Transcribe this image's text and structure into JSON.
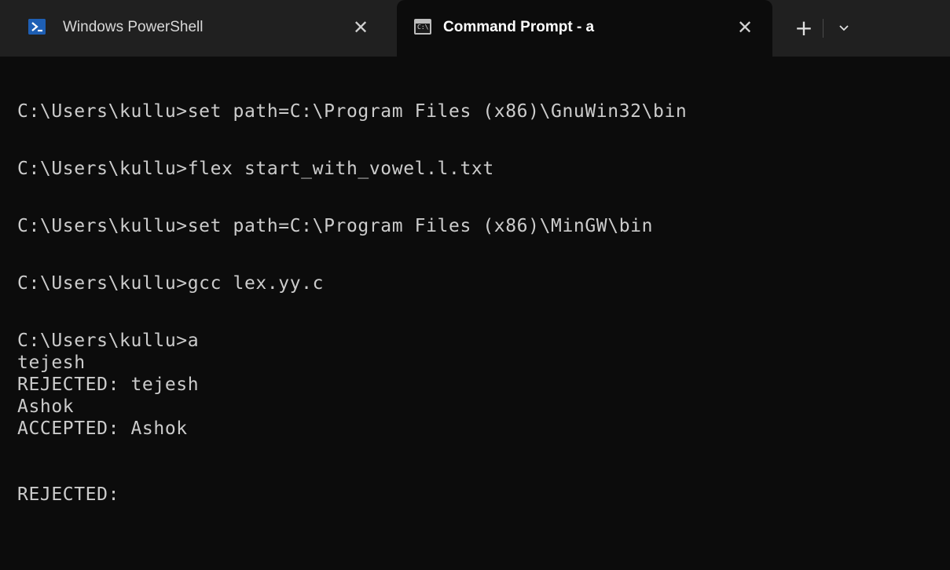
{
  "tabs": [
    {
      "title": "Windows PowerShell",
      "icon": "powershell-icon",
      "active": false
    },
    {
      "title": "Command Prompt - a",
      "icon": "cmd-icon",
      "active": true
    }
  ],
  "tab_close_glyph": "✕",
  "new_tab_glyph": "+",
  "terminal": {
    "lines": [
      "C:\\Users\\kullu>set path=C:\\Program Files (x86)\\GnuWin32\\bin",
      "",
      "C:\\Users\\kullu>flex start_with_vowel.l.txt",
      "",
      "C:\\Users\\kullu>set path=C:\\Program Files (x86)\\MinGW\\bin",
      "",
      "C:\\Users\\kullu>gcc lex.yy.c",
      "",
      "C:\\Users\\kullu>a",
      "tejesh",
      "REJECTED: tejesh",
      "Ashok",
      "ACCEPTED: Ashok",
      "",
      "",
      "REJECTED:"
    ]
  },
  "colors": {
    "tabbar_bg": "#202020",
    "terminal_bg": "#0c0c0c",
    "terminal_text": "#cccccc",
    "powershell_blue": "#1e5fb4"
  }
}
